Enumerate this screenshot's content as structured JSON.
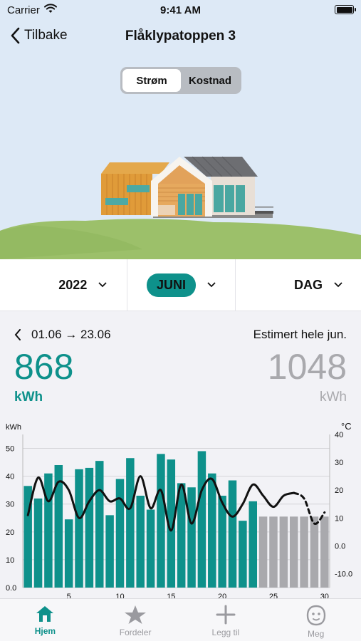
{
  "status": {
    "carrier": "Carrier",
    "time": "9:41 AM"
  },
  "nav": {
    "back_label": "Tilbake",
    "title": "Flåklypatoppen 3"
  },
  "segment": {
    "options": [
      "Strøm",
      "Kostnad"
    ],
    "selected": "Strøm"
  },
  "pickers": {
    "year": "2022",
    "month": "JUNI",
    "granularity": "DAG"
  },
  "summary": {
    "range": "01.06 → 23.06",
    "estimate_label": "Estimert hele jun.",
    "actual_value": "868",
    "actual_unit": "kWh",
    "estimate_value": "1048",
    "estimate_unit": "kWh"
  },
  "colors": {
    "accent": "#0e918b",
    "bar_actual": "#0e918b",
    "bar_estimate": "#a9a9ad",
    "hero_sky": "#dde9f6",
    "hill": "#9cc06a"
  },
  "chart_data": {
    "type": "bar",
    "y_left_label": "kWh",
    "y_right_label": "°C",
    "y_left_ticks": [
      "0.0",
      "10",
      "20",
      "30",
      "40",
      "50"
    ],
    "y_right_ticks": [
      "-10.0",
      "0.0",
      "10",
      "20",
      "30",
      "40"
    ],
    "x_ticks": [
      "5",
      "10",
      "15",
      "20",
      "25",
      "30"
    ],
    "ylim_left": [
      0,
      55
    ],
    "ylim_right": [
      -15,
      40
    ],
    "series": [
      {
        "name": "actual",
        "days": [
          1,
          2,
          3,
          4,
          5,
          6,
          7,
          8,
          9,
          10,
          11,
          12,
          13,
          14,
          15,
          16,
          17,
          18,
          19,
          20,
          21,
          22,
          23
        ],
        "values": [
          36.5,
          32,
          41,
          44,
          24.5,
          42.5,
          43,
          45.5,
          26,
          39,
          46.5,
          33,
          28,
          48,
          46,
          37.5,
          36,
          49,
          41,
          33,
          38.5,
          24,
          31
        ]
      },
      {
        "name": "estimate",
        "days": [
          24,
          25,
          26,
          27,
          28,
          29,
          30
        ],
        "values": [
          25.5,
          25.5,
          25.5,
          25.5,
          25.5,
          25.5,
          25.5
        ]
      },
      {
        "name": "temperature",
        "days": [
          1,
          2,
          3,
          4,
          5,
          6,
          7,
          8,
          9,
          10,
          11,
          12,
          13,
          14,
          15,
          16,
          17,
          18,
          19,
          20,
          21,
          22,
          23,
          24,
          25,
          26,
          27,
          28,
          29,
          30
        ],
        "values": [
          11,
          24.5,
          16,
          23,
          20,
          10,
          16,
          20,
          16,
          17,
          13.5,
          25,
          13.5,
          20,
          5.5,
          22,
          8,
          20,
          24,
          15.5,
          10.5,
          15,
          22,
          18,
          14,
          18,
          19,
          17,
          8,
          12
        ]
      }
    ]
  },
  "tabs": [
    {
      "label": "Hjem",
      "icon": "home-icon",
      "active": true
    },
    {
      "label": "Fordeler",
      "icon": "star-icon",
      "active": false
    },
    {
      "label": "Legg til",
      "icon": "plus-icon",
      "active": false
    },
    {
      "label": "Meg",
      "icon": "face-icon",
      "active": false
    }
  ]
}
